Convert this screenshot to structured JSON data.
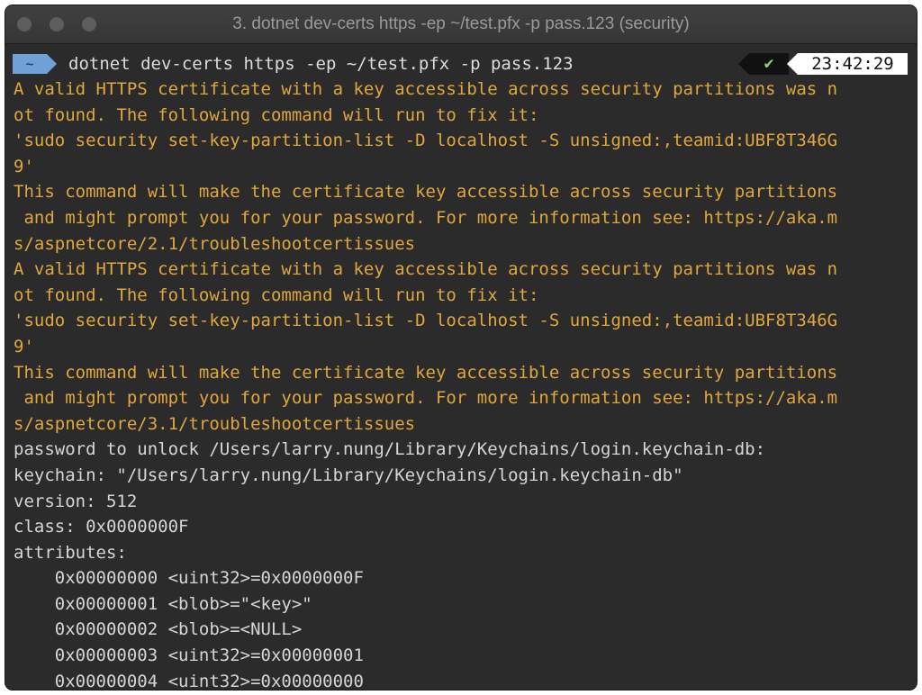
{
  "window": {
    "title": "3. dotnet dev-certs https -ep ~/test.pfx -p pass.123 (security)"
  },
  "prompt": {
    "dir": "~",
    "command": "dotnet dev-certs https -ep ~/test.pfx -p pass.123",
    "status_icon": "check-icon",
    "status_glyph": "✔",
    "time": "23:42:29"
  },
  "colors": {
    "warning_text": "#e0a73c",
    "normal_text": "#d6d6d6",
    "prompt_badge": "#6fa1d6",
    "success_check": "#8bd46f"
  },
  "output": [
    {
      "text": "A valid HTTPS certificate with a key accessible across security partitions was n",
      "style": "warn"
    },
    {
      "text": "ot found. The following command will run to fix it:",
      "style": "warn"
    },
    {
      "text": "'sudo security set-key-partition-list -D localhost -S unsigned:,teamid:UBF8T346G",
      "style": "warn"
    },
    {
      "text": "9'",
      "style": "warn"
    },
    {
      "text": "This command will make the certificate key accessible across security partitions",
      "style": "warn"
    },
    {
      "text": " and might prompt you for your password. For more information see: https://aka.m",
      "style": "warn"
    },
    {
      "text": "s/aspnetcore/2.1/troubleshootcertissues",
      "style": "warn"
    },
    {
      "text": "A valid HTTPS certificate with a key accessible across security partitions was n",
      "style": "warn"
    },
    {
      "text": "ot found. The following command will run to fix it:",
      "style": "warn"
    },
    {
      "text": "'sudo security set-key-partition-list -D localhost -S unsigned:,teamid:UBF8T346G",
      "style": "warn"
    },
    {
      "text": "9'",
      "style": "warn"
    },
    {
      "text": "This command will make the certificate key accessible across security partitions",
      "style": "warn"
    },
    {
      "text": " and might prompt you for your password. For more information see: https://aka.m",
      "style": "warn"
    },
    {
      "text": "s/aspnetcore/3.1/troubleshootcertissues",
      "style": "warn"
    },
    {
      "text": "password to unlock /Users/larry.nung/Library/Keychains/login.keychain-db:",
      "style": "norm"
    },
    {
      "text": "keychain: \"/Users/larry.nung/Library/Keychains/login.keychain-db\"",
      "style": "norm"
    },
    {
      "text": "version: 512",
      "style": "norm"
    },
    {
      "text": "class: 0x0000000F",
      "style": "norm"
    },
    {
      "text": "attributes:",
      "style": "norm"
    },
    {
      "text": "    0x00000000 <uint32>=0x0000000F",
      "style": "norm"
    },
    {
      "text": "    0x00000001 <blob>=\"<key>\"",
      "style": "norm"
    },
    {
      "text": "    0x00000002 <blob>=<NULL>",
      "style": "norm"
    },
    {
      "text": "    0x00000003 <uint32>=0x00000001",
      "style": "norm"
    },
    {
      "text": "    0x00000004 <uint32>=0x00000000",
      "style": "norm"
    }
  ]
}
